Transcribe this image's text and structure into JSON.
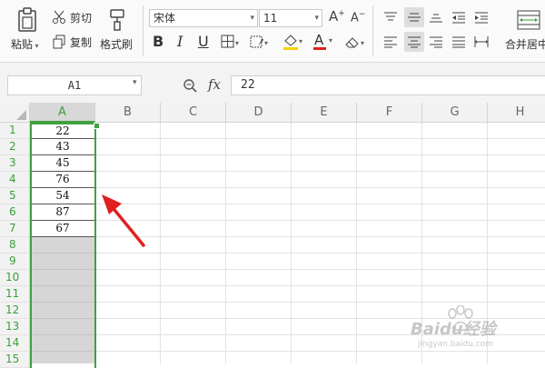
{
  "toolbar": {
    "paste_label": "粘贴",
    "cut_label": "剪切",
    "copy_label": "复制",
    "format_painter_label": "格式刷",
    "font_name": "宋体",
    "font_size": "11",
    "bold": "B",
    "italic": "I",
    "underline": "U",
    "font_color_letter": "A",
    "grow_font": "A",
    "shrink_font": "A",
    "merge_center_label": "合并居中"
  },
  "formula_bar": {
    "name_box": "A1",
    "fx_label": "fx",
    "content": "22"
  },
  "sheet": {
    "columns": [
      "A",
      "B",
      "C",
      "D",
      "E",
      "F",
      "G",
      "H"
    ],
    "rows": [
      "1",
      "2",
      "3",
      "4",
      "5",
      "6",
      "7",
      "8",
      "9",
      "10",
      "11",
      "12",
      "13",
      "14",
      "15"
    ],
    "column_a_values": [
      "22",
      "43",
      "45",
      "76",
      "54",
      "87",
      "67"
    ],
    "selected_column": "A",
    "active_cell": "A1"
  },
  "watermark": {
    "text": "Baidu经验",
    "url": "jingyan.baidu.com"
  },
  "colors": {
    "selection_green": "#3fa142",
    "annotation_arrow": "#e02020",
    "selected_column_fill": "#d6d6d6"
  },
  "icons": [
    "paste-icon",
    "cut-icon",
    "copy-icon",
    "format-painter-icon",
    "border-icon",
    "fill-color-icon",
    "clear-icon",
    "align-icons",
    "merge-icon",
    "zoom-icon"
  ]
}
